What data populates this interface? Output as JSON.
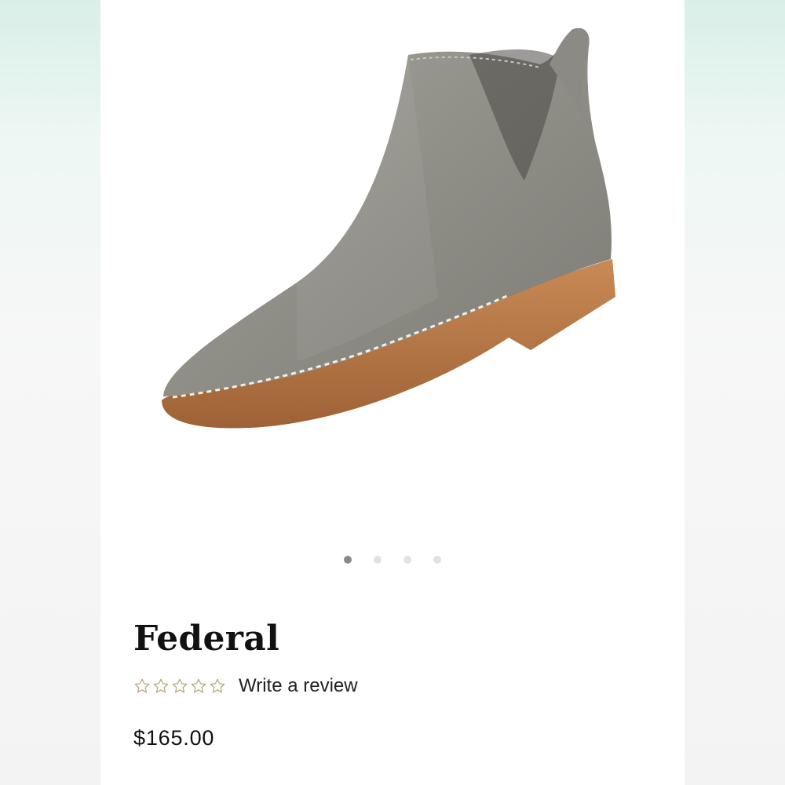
{
  "product": {
    "title": "Federal",
    "price": "$165.00",
    "review_link": "Write a review",
    "rating": 0,
    "rating_max": 5
  },
  "carousel": {
    "count": 4,
    "active_index": 0
  },
  "colors": {
    "star_outline": "#b7a77a",
    "dot_active": "#8a8a8a",
    "dot_inactive": "#e2e2e2"
  },
  "icons": {
    "star": "star-outline-icon"
  }
}
